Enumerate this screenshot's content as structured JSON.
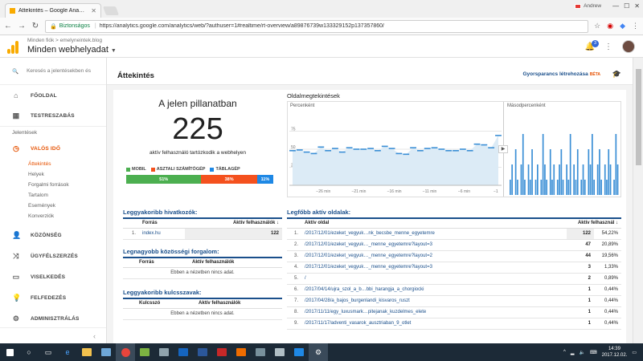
{
  "browser": {
    "tab_title": "Áttekintés – Google Ana…",
    "profile_name": "Andrew",
    "secure_label": "Biztonságos",
    "url": "https://analytics.google.com/analytics/web/?authuser=1#realtime/rt-overview/a89876739w133329152p137357860/"
  },
  "header": {
    "breadcrumb": "Minden fiók > emelyneintek.blog",
    "account_select": "Minden webhelyadat",
    "notification_count": "3"
  },
  "sidebar": {
    "search_placeholder": "Keresés a jelentésekben és",
    "home": "FŐOLDAL",
    "customization": "TESTRESZABÁS",
    "reports_label": "Jelentések",
    "realtime": "VALÓS IDŐ",
    "realtime_subs": [
      "Áttekintés",
      "Helyek",
      "Forgalmi források",
      "Tartalom",
      "Események",
      "Konverziók"
    ],
    "audience": "KÖZÖNSÉG",
    "acquisition": "ÜGYFÉLSZERZÉS",
    "behavior": "VISELKEDÉS",
    "discover": "FELFEDEZÉS",
    "admin": "ADMINISZTRÁLÁS"
  },
  "page": {
    "title": "Áttekintés",
    "shortcut": "Gyorsparancs létrehozása",
    "beta": "BÉTA"
  },
  "now": {
    "title": "A jelen pillanatban",
    "count": "225",
    "subtitle": "aktív felhasználó tartózkodik a webhelyen",
    "devices": [
      {
        "label": "MOBIL",
        "pct": "51%",
        "share": 51,
        "color": "#4caf50"
      },
      {
        "label": "ASZTALI SZÁMÍTÓGÉP",
        "pct": "38%",
        "share": 38,
        "color": "#f4511e"
      },
      {
        "label": "TÁBLAGÉP",
        "pct": "11%",
        "share": 11,
        "color": "#1e88e5"
      }
    ]
  },
  "pageviews": {
    "title": "Oldalmegtekintések",
    "per_minute_label": "Percenként",
    "per_second_label": "Másodpercenként",
    "y_ticks": [
      "75",
      "50",
      "25"
    ],
    "x_ticks": [
      "−26 min",
      "−21 min",
      "−16 min",
      "−11 min",
      "−6 min",
      "−1"
    ]
  },
  "chart_data": {
    "type": "line",
    "title": "Oldalmegtekintések",
    "ylim": [
      0,
      100
    ],
    "series": [
      {
        "name": "Percenként",
        "x": [
          -30,
          -29,
          -28,
          -27,
          -26,
          -25,
          -24,
          -23,
          -22,
          -21,
          -20,
          -19,
          -18,
          -17,
          -16,
          -15,
          -14,
          -13,
          -12,
          -11,
          -10,
          -9,
          -8,
          -7,
          -6,
          -5,
          -4,
          -3,
          -2,
          -1
        ],
        "values": [
          48,
          49,
          46,
          44,
          53,
          48,
          51,
          46,
          52,
          50,
          50,
          51,
          48,
          54,
          51,
          44,
          43,
          52,
          48,
          51,
          52,
          50,
          48,
          48,
          50,
          48,
          57,
          56,
          52,
          69
        ]
      },
      {
        "name": "Másodpercenként",
        "values": [
          1,
          2,
          0,
          3,
          1,
          0,
          2,
          4,
          1,
          0,
          2,
          1,
          3,
          0,
          1,
          2,
          0,
          1,
          4,
          2,
          1,
          0,
          3,
          1,
          2,
          0,
          1,
          2,
          3,
          1,
          0,
          2,
          1,
          4,
          0,
          2,
          1,
          3,
          0,
          1,
          2,
          1,
          0,
          3,
          2,
          4,
          1,
          0,
          2,
          3,
          1,
          0,
          2,
          1,
          3,
          2,
          0,
          1,
          4,
          2
        ]
      }
    ]
  },
  "referrers": {
    "title": "Leggyakoribb hivatkozók:",
    "col_source": "Forrás",
    "col_users": "Aktív felhasználók",
    "rows": [
      {
        "idx": "1.",
        "source": "index.hu",
        "users": "122"
      }
    ]
  },
  "social": {
    "title": "Legnagyobb közösségi forgalom:",
    "col_source": "Forrás",
    "col_users": "Aktív felhasználók",
    "empty": "Ebben a nézetben nincs adat."
  },
  "keywords": {
    "title": "Leggyakoribb kulcsszavak:",
    "col_keyword": "Kulcsszó",
    "col_users": "Aktív felhasználók",
    "empty": "Ebben a nézetben nincs adat."
  },
  "pages": {
    "title": "Legfőbb aktív oldalak:",
    "col_page": "Aktív oldal",
    "col_users": "Aktív felhasznál",
    "rows": [
      {
        "idx": "1.",
        "page": "/2017/12/01/ezeket_vegyuk…nk_becsbe_menne_egyetemre",
        "users": "122",
        "pct": "54,22%"
      },
      {
        "idx": "2.",
        "page": "/2017/12/01/ezeket_vegyuk…_menne_egyetemre?layout=3",
        "users": "47",
        "pct": "20,89%"
      },
      {
        "idx": "3.",
        "page": "/2017/12/01/ezeket_vegyuk…_menne_egyetemre?layout=2",
        "users": "44",
        "pct": "19,56%"
      },
      {
        "idx": "4.",
        "page": "/2017/12/01/ezeket_vegyuk…_menne_egyetemre?layout=3",
        "users": "3",
        "pct": "1,33%"
      },
      {
        "idx": "5.",
        "page": "/",
        "users": "2",
        "pct": "0,89%"
      },
      {
        "idx": "6.",
        "page": "/2017/04/14/ujra_szol_a_b…bbi_harangja_a_chorgiocki",
        "users": "1",
        "pct": "0,44%"
      },
      {
        "idx": "7.",
        "page": "/2017/04/28/a_bajos_burgenlandi_kisvaros_ruszt",
        "users": "1",
        "pct": "0,44%"
      },
      {
        "idx": "8.",
        "page": "/2017/11/11/egy_luxusmark…pitejanak_kuzdelmes_elete",
        "users": "1",
        "pct": "0,44%"
      },
      {
        "idx": "9.",
        "page": "/2017/11/17/adventi_vasarok_ausztriaban_9_otlet",
        "users": "1",
        "pct": "0,44%"
      }
    ]
  },
  "taskbar": {
    "time": "14:39",
    "date": "2017.12.02."
  }
}
